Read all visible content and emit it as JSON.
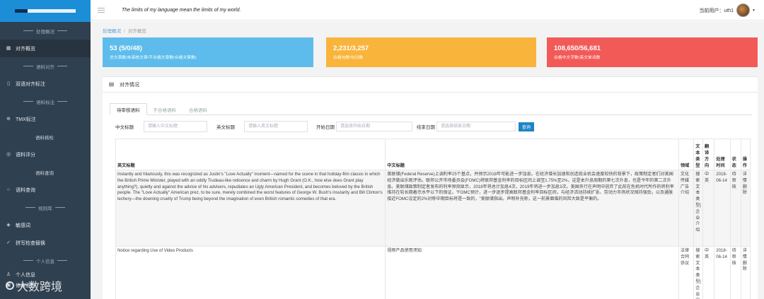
{
  "header": {
    "motto": "The limits of my language mean the limits of my world.",
    "user_label": "当前用户：uth1"
  },
  "sidebar": {
    "sections": {
      "s1": "处理概况",
      "s2": "语料对齐",
      "s3": "语料标注",
      "s4": "规则库",
      "s5": "个人信息"
    },
    "items": {
      "overview": "对齐概览",
      "bilingual": "双语对齐标注",
      "tmx": "TMX标注",
      "corpus_check": "语料核检",
      "corpus_score": "语料评分",
      "corpus_query": "语料查询",
      "corpus_search": "语料查询",
      "sensitive": "敏感词",
      "spell": "拼写检查替换",
      "personal": "个人信息",
      "password": "修改密码"
    }
  },
  "breadcrumb": {
    "home": "处理概况",
    "sep": "/",
    "current": "对齐概览"
  },
  "cards": [
    {
      "value": "53 (5/0/48)",
      "label": "总文章数/未审核文章/不合格文章数/合格文章数)",
      "color": "#5ebcec"
    },
    {
      "value": "2,231/3,257",
      "label": "合格句数/句对数",
      "color": "#f9b43b"
    },
    {
      "value": "108,650/56,681",
      "label": "合格中文字数/英文单词数",
      "color": "#f25a58"
    }
  ],
  "panel": {
    "title": "对齐情况"
  },
  "tabs": [
    "待审核语料",
    "不合格语料",
    "合格语料"
  ],
  "filters": {
    "cn_title_label": "中文标题",
    "cn_title_placeholder": "请输入中文标题",
    "en_title_label": "英文标题",
    "en_title_placeholder": "请输入英文标题",
    "start_label": "开始日期",
    "start_placeholder": "请选择开始日期",
    "end_label": "结束日期",
    "end_placeholder": "请选择结束日期",
    "query_button": "查询"
  },
  "table": {
    "headers": [
      "英文标题",
      "中文标题",
      "领域",
      "文本类型",
      "翻译方向",
      "处理时间",
      "状态",
      "操作"
    ],
    "rows": [
      {
        "en": "Instantly and hilariously, this was recognized as Justin's \"Love Actually\" moment—named for the scene in that holiday-film classic in which the British Prime Minister, played with an oddly Trudeau-like reticence and charm by Hugh Grant (O.K., how else does Grant play anything?), quietly and against the advice of his advisers, repudiates an Ugly American President, and becomes beloved by the British people. The \"Love Actually\" American prez, to be sure, merely combined the worst features of George W. Bush's insularity and Bill Clinton's lechery—the downing cruelty of Trump being beyond the imagination of even British romantic comedies of that era.",
        "cn": "美联储(Federal Reserve)上调利率25个基点，并预示2018年可能进一步加息。在经济增长加速和创造就业机会速度较快的背景下，政策制定者们对美国经济做出乐观评估。联邦公开市场委员会(FOMC)将联邦基金利率的目标区间上调至1.75%至2%，这是本升息周期的第七次升息，也是今年的第二次升息。美联储政策制定者发布的利率预测显示，2018年将总计加息4次，2019年将进一步加息3次。美国央行在声明中放弃了此前在危机时代所作的将利率维持在较长期着示水平以下的保证。\"FOMC预计，进一步逐步提高联邦基金利率目标区间，与经济活动持续扩张、劳动力市场状况保持强劲，以及通胀接近FOMC设定的2%对称中期目标将是一致的，\"美联储指出。声明补充称，这一前景面临的风险大致是平衡的。",
        "domain": "文化传媒广告介绍",
        "type": "搜索文本类型|企业介绍",
        "direction": "中英",
        "time": "2018-06-14",
        "status": "待审核",
        "ops": "详情删除"
      },
      {
        "en": "Notice regarding Use of Video Products",
        "cn": "视频产品使用须知",
        "domain": "法律合同协议",
        "type": "搜索文本类型|企业介",
        "direction": "中英",
        "time": "2018-06-14",
        "status": "待审核",
        "ops": "详情删除"
      }
    ]
  },
  "watermark": "大数跨境"
}
